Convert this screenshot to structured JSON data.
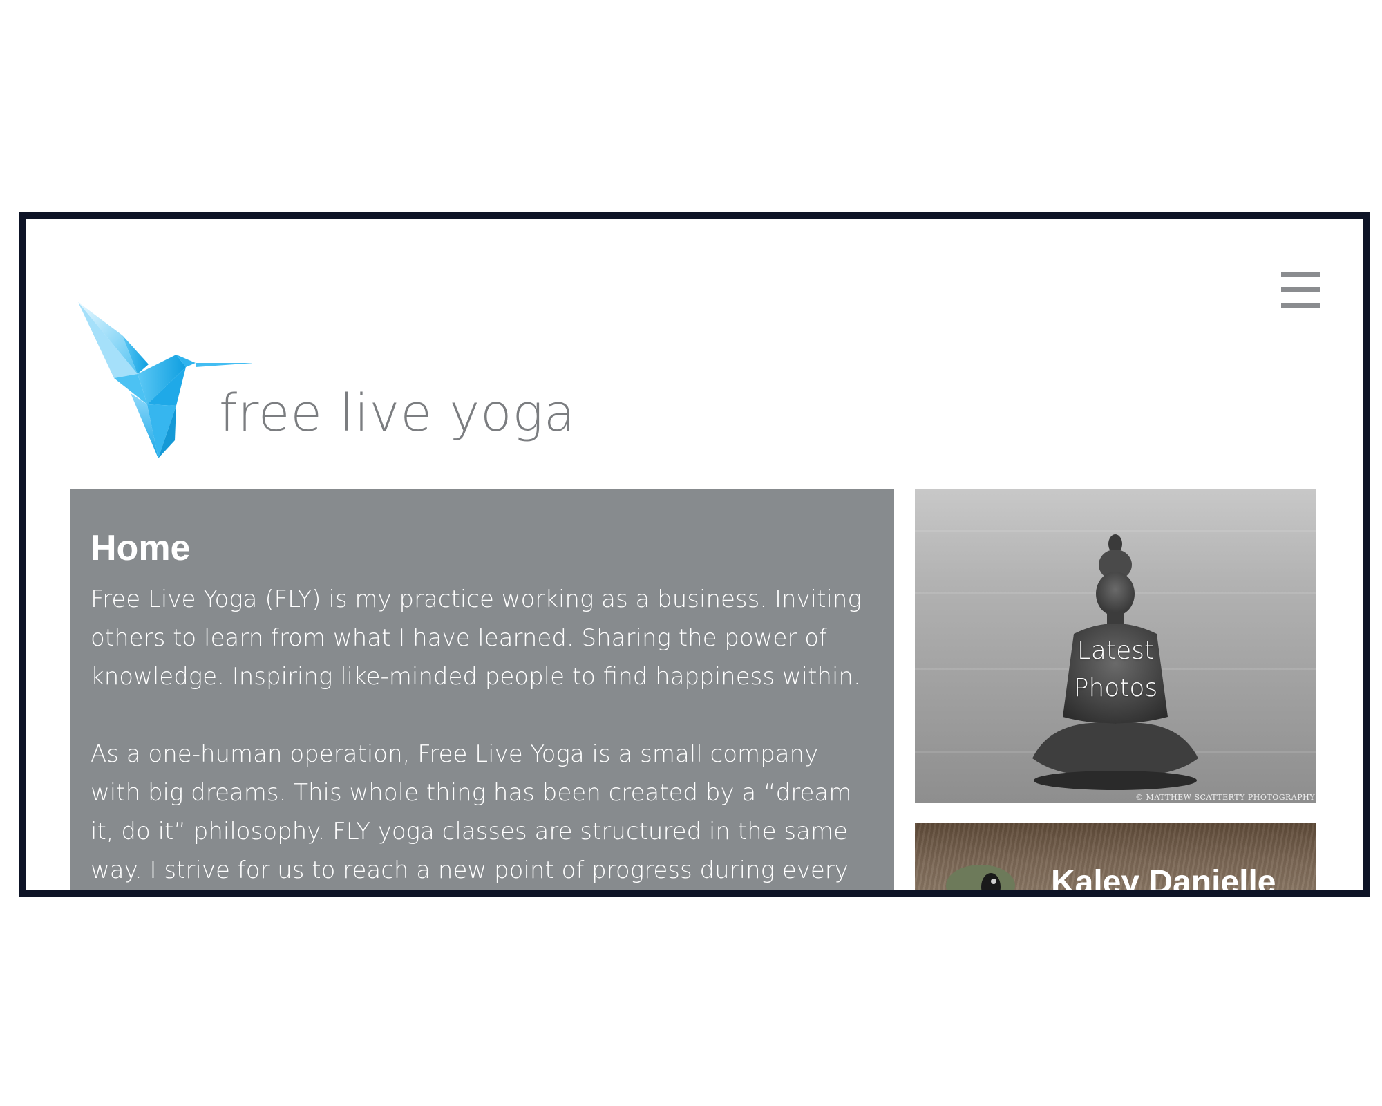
{
  "header": {
    "logo_text": "free live yoga",
    "menu_icon": "hamburger-menu-icon"
  },
  "main": {
    "title": "Home",
    "paragraphs": [
      "Free Live Yoga (FLY) is my practice working as a business. Inviting others to learn from what I have learned. Sharing the power of knowledge. Inspiring like-minded people to find happiness within.",
      "As a one-human operation, Free Live Yoga is a small company with big dreams. This whole thing has been created by a “dream it, do it” philosophy. FLY yoga classes are structured in the same way. I strive for us to reach a new point of progress during every lesson by"
    ]
  },
  "sidebar": {
    "photos_card": {
      "label_line1": "Latest",
      "label_line2": "Photos",
      "watermark": "© MATTHEW SCATTERTY PHOTOGRAPHY"
    },
    "profile_card": {
      "name": "Kaley Danielle"
    }
  },
  "colors": {
    "frame_border": "#0e1427",
    "panel_bg": "#878b8e",
    "logo_blue": "#29b6f6",
    "logo_text": "#7b7d80",
    "menu_icon": "#8a8c8f"
  }
}
